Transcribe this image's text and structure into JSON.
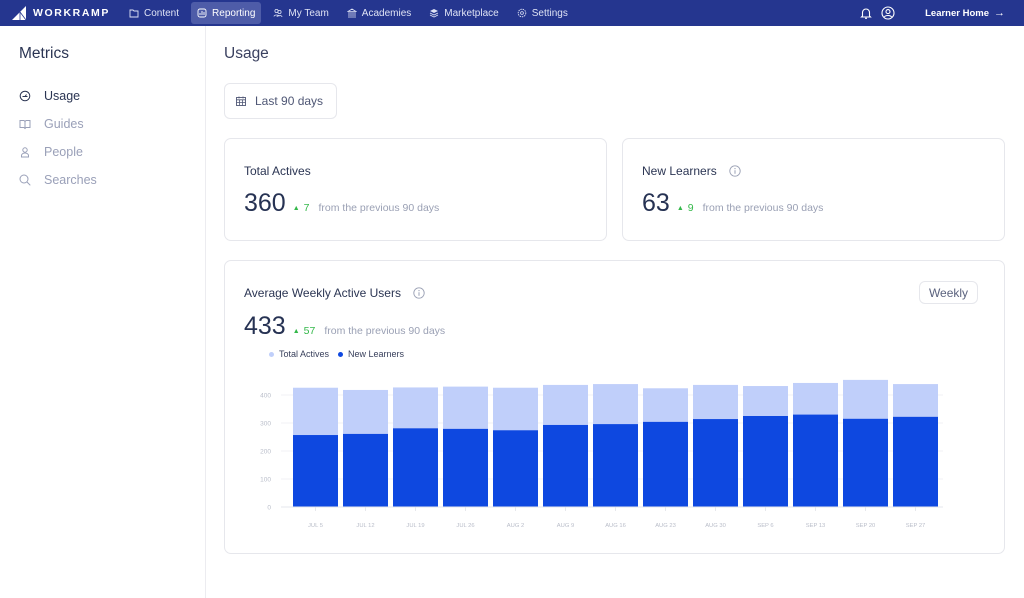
{
  "topnav": {
    "brand": "WORKRAMP",
    "items": [
      {
        "label": "Content",
        "icon": "folder-icon",
        "active": false
      },
      {
        "label": "Reporting",
        "icon": "reporting-icon",
        "active": true
      },
      {
        "label": "My Team",
        "icon": "team-icon",
        "active": false
      },
      {
        "label": "Academies",
        "icon": "academy-icon",
        "active": false
      },
      {
        "label": "Marketplace",
        "icon": "marketplace-icon",
        "active": false
      },
      {
        "label": "Settings",
        "icon": "gear-icon",
        "active": false
      }
    ],
    "learner_home": "Learner Home",
    "learner_home_arrow": "→"
  },
  "sidebar": {
    "title": "Metrics",
    "items": [
      {
        "label": "Usage",
        "icon": "gauge-icon",
        "active": true
      },
      {
        "label": "Guides",
        "icon": "book-icon",
        "active": false
      },
      {
        "label": "People",
        "icon": "person-icon",
        "active": false
      },
      {
        "label": "Searches",
        "icon": "search-icon",
        "active": false
      }
    ]
  },
  "main": {
    "title": "Usage",
    "date_range": "Last 90 days",
    "cards": {
      "total_actives": {
        "title": "Total Actives",
        "value": "360",
        "delta": "7",
        "delta_dir": "▲",
        "sub": "from the previous 90 days"
      },
      "new_learners": {
        "title": "New Learners",
        "value": "63",
        "delta": "9",
        "delta_dir": "▲",
        "sub": "from the previous 90 days"
      },
      "awau": {
        "title": "Average Weekly Active Users",
        "value": "433",
        "delta": "57",
        "delta_dir": "▲",
        "sub": "from the previous 90 days",
        "granularity": "Weekly"
      }
    }
  },
  "colors": {
    "nav_bg": "#25368f",
    "total_actives": "#c0cffa",
    "new_learners": "#0e48e0",
    "delta_up": "#34b84a"
  },
  "chart_data": {
    "type": "bar",
    "title": "Average Weekly Active Users",
    "categories": [
      "JUL 5",
      "JUL 12",
      "JUL 19",
      "JUL 26",
      "AUG 2",
      "AUG 9",
      "AUG 16",
      "AUG 23",
      "AUG 30",
      "SEP 6",
      "SEP 13",
      "SEP 20",
      "SEP 27"
    ],
    "series": [
      {
        "name": "Total Actives",
        "color": "#c0cffa",
        "values": [
          426,
          418,
          427,
          430,
          426,
          436,
          439,
          424,
          436,
          432,
          443,
          454,
          439
        ]
      },
      {
        "name": "New Learners",
        "color": "#0e48e0",
        "values": [
          257,
          261,
          281,
          279,
          274,
          293,
          296,
          304,
          314,
          325,
          330,
          315,
          322
        ]
      }
    ],
    "bar_mode": "overlay",
    "xlabel": "",
    "ylabel": "",
    "yticks": [
      0,
      100,
      200,
      300,
      400
    ],
    "ylim": [
      0,
      400
    ],
    "grid": true,
    "legend": "top-left"
  }
}
